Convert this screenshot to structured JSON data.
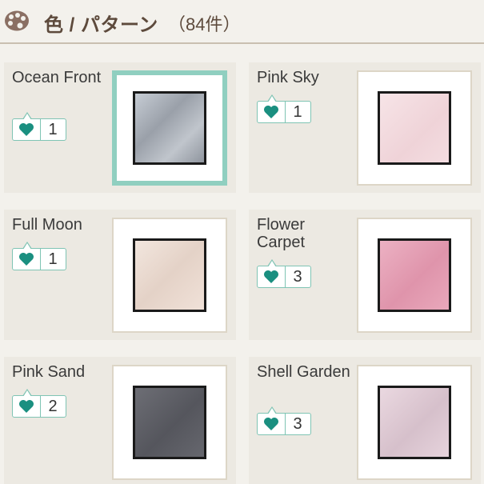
{
  "header": {
    "title": "色 / パターン",
    "count": "（84件）",
    "icon": "palette-icon"
  },
  "colors": {
    "accent": "#90cfc0",
    "heart": "#1a8f80",
    "text": "#5d4a3c"
  },
  "items": [
    {
      "name": "Ocean Front",
      "likes": "1",
      "swatch_color": "#aeb3bb",
      "selected": true
    },
    {
      "name": "Pink Sky",
      "likes": "1",
      "swatch_color": "#f2d9dd",
      "selected": false
    },
    {
      "name": "Full Moon",
      "likes": "1",
      "swatch_color": "#ecdcd2",
      "selected": false
    },
    {
      "name": "Flower Carpet",
      "likes": "3",
      "swatch_color": "#e6a3b8",
      "selected": false
    },
    {
      "name": "Pink Sand",
      "likes": "2",
      "swatch_color": "#606168",
      "selected": false
    },
    {
      "name": "Shell Garden",
      "likes": "3",
      "swatch_color": "#e0ccd6",
      "selected": false
    }
  ]
}
